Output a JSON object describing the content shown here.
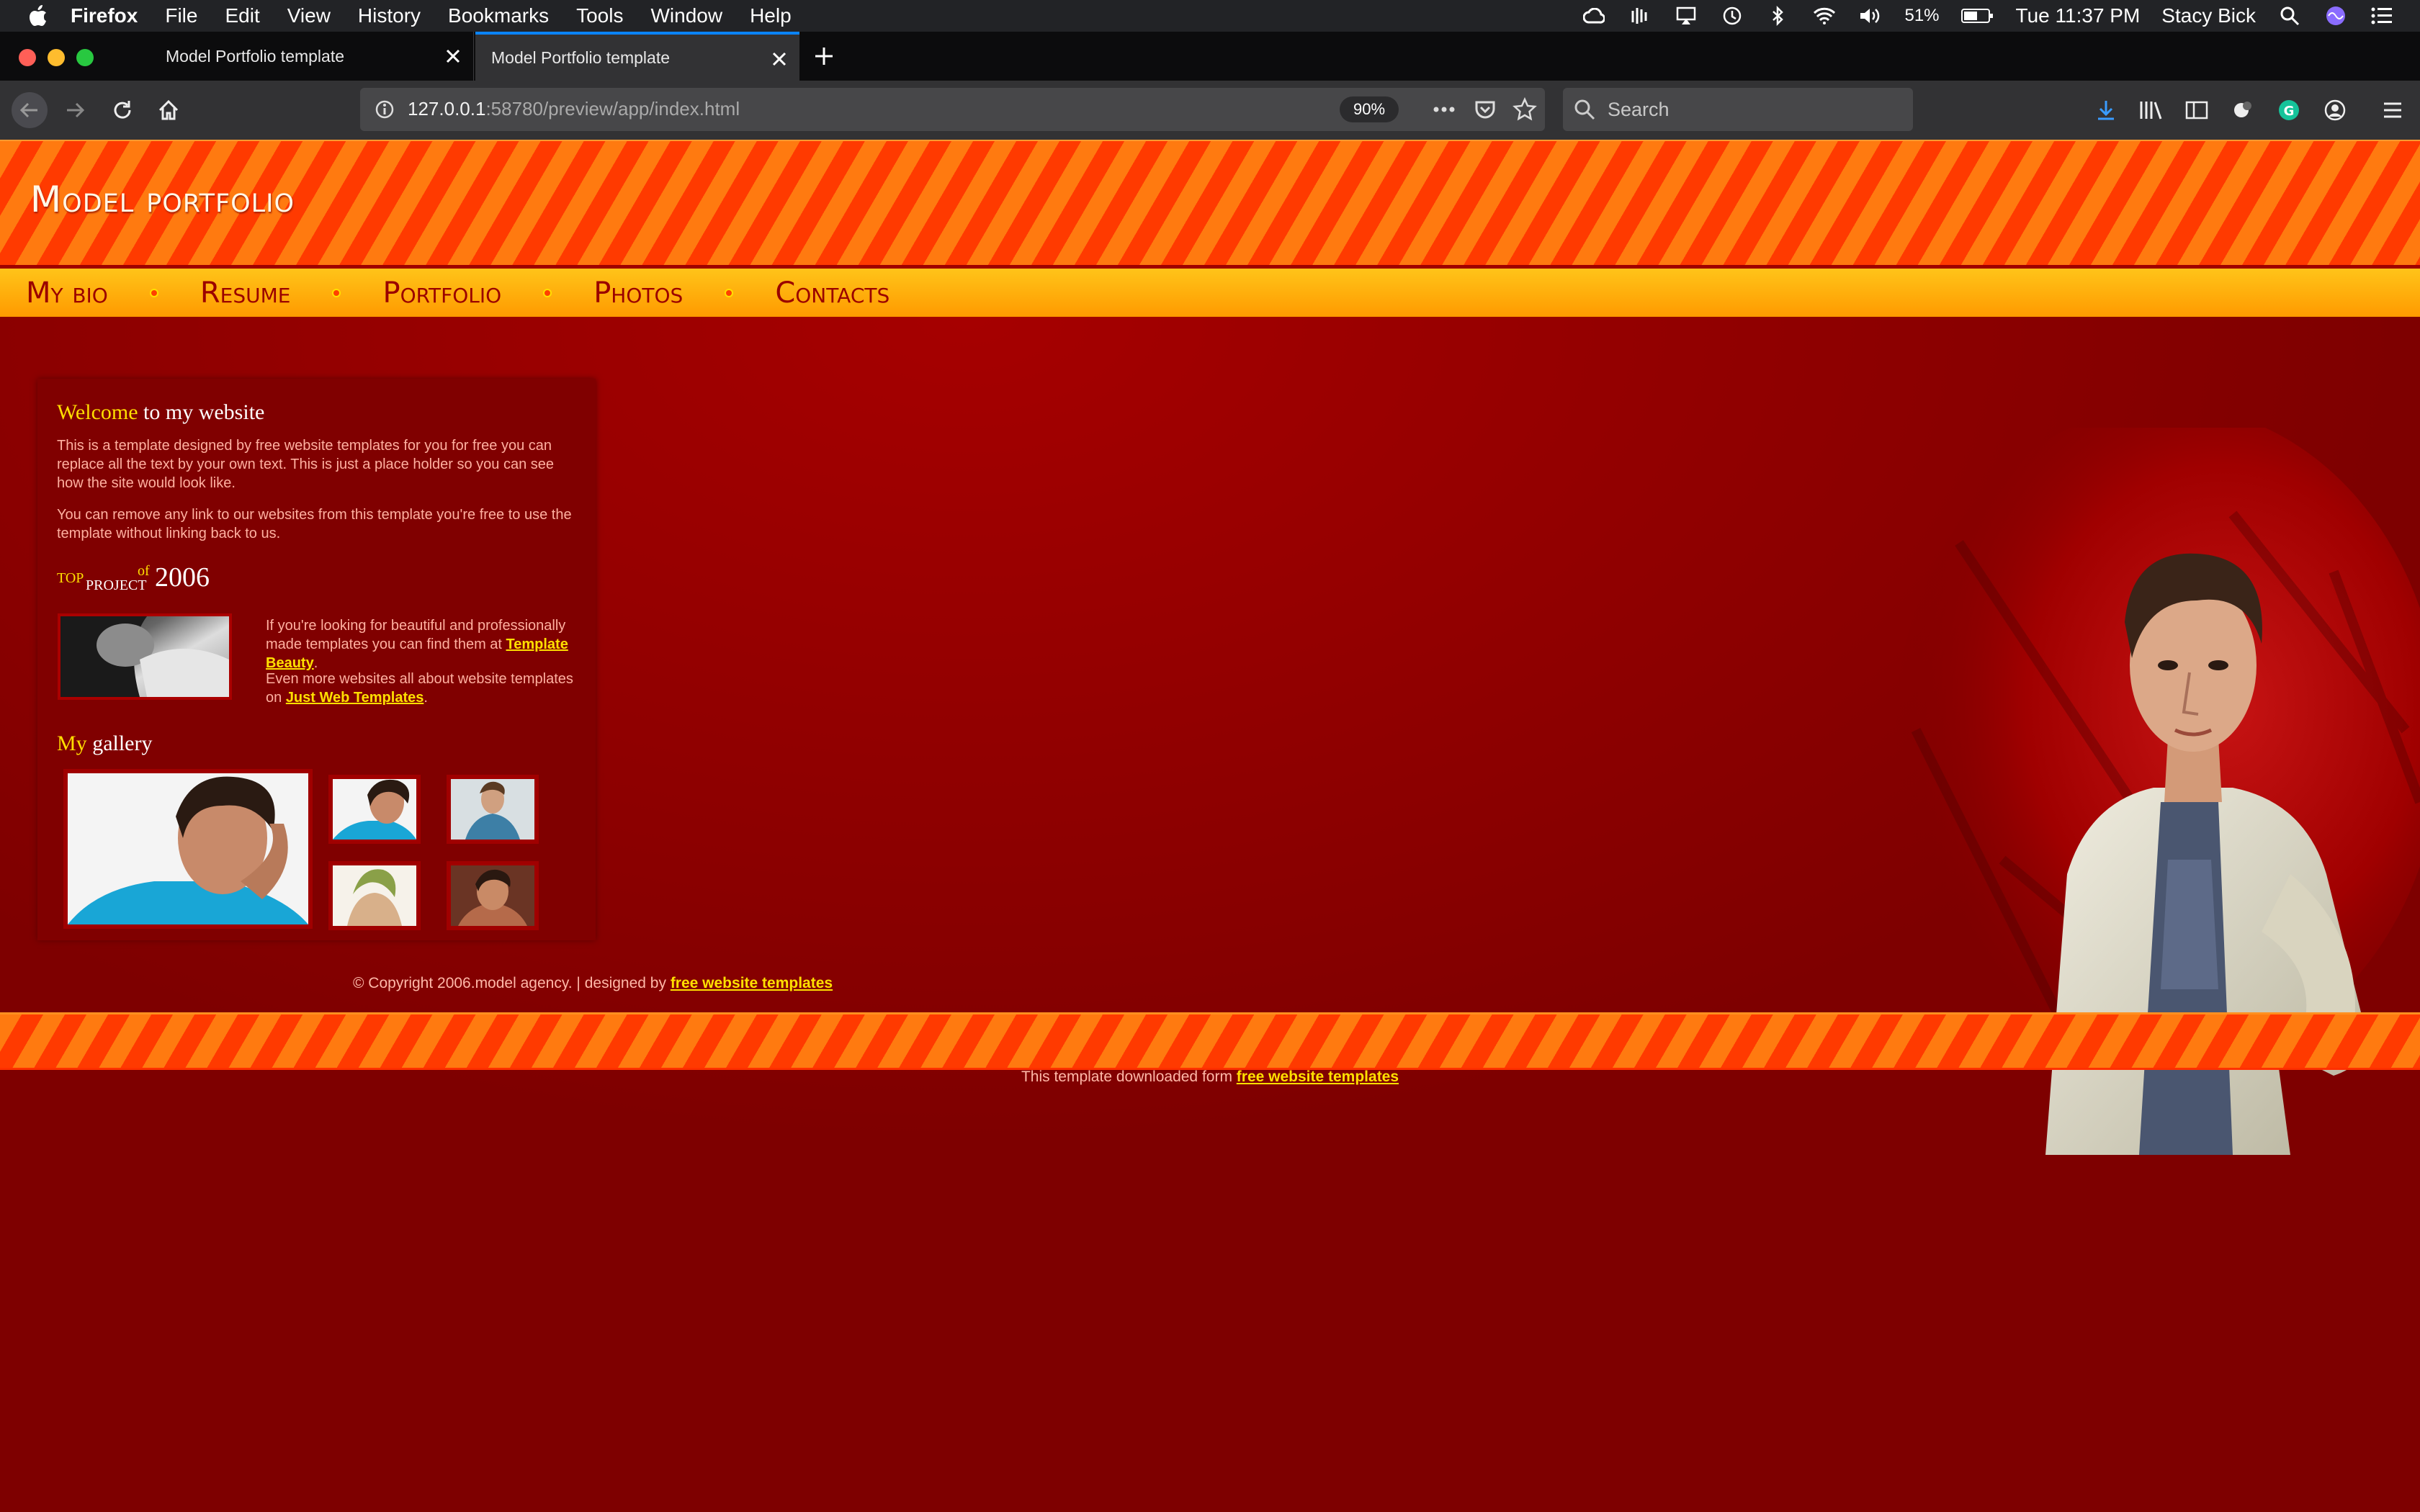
{
  "menubar": {
    "app": "Firefox",
    "menus": [
      "File",
      "Edit",
      "View",
      "History",
      "Bookmarks",
      "Tools",
      "Window",
      "Help"
    ],
    "battery": "51%",
    "clock": "Tue 11:37 PM",
    "user": "Stacy Bick"
  },
  "tabs": [
    {
      "title": "Model Portfolio template"
    },
    {
      "title": "Model Portfolio template"
    }
  ],
  "navbar": {
    "url_host": "127.0.0.1",
    "url_rest": ":58780/preview/app/index.html",
    "zoom": "90%",
    "search_placeholder": "Search"
  },
  "site": {
    "title": "Model portfolio",
    "nav": [
      "My bio",
      "Resume",
      "Portfolio",
      "Photos",
      "Contacts"
    ],
    "welcome": {
      "highlight": "Welcome",
      "rest": " to my website"
    },
    "para1": "This is a template designed by free website templates for you for free you can replace all the text by your own text. This is just a place holder so you can see how the site would look like.",
    "para2": "You can remove any link to our websites from this template you're free to use the template without linking back to us.",
    "top_project": {
      "top": "TOP",
      "project": "PROJECT",
      "of": "of",
      "year": "2006"
    },
    "promo1_pre": "If you're looking for beautiful and professionally made templates you can find them at ",
    "promo1_link": "Template Beauty",
    "promo1_post": ".",
    "promo2_pre": "Even more websites all about website templates on ",
    "promo2_link": "Just Web Templates",
    "promo2_post": ".",
    "gallery": {
      "highlight": "My",
      "rest": " gallery"
    },
    "copyright_pre": "© Copyright 2006.model agency. | designed by ",
    "copyright_link": "free website templates",
    "download_pre": "This template downloaded form ",
    "download_link": "free website templates"
  },
  "colors": {
    "menubar": "#222326",
    "tab_active_accent": "#0a84ff",
    "page_bg": "#7e0000",
    "nav_text": "#9a0000",
    "highlight": "#ffde00"
  }
}
